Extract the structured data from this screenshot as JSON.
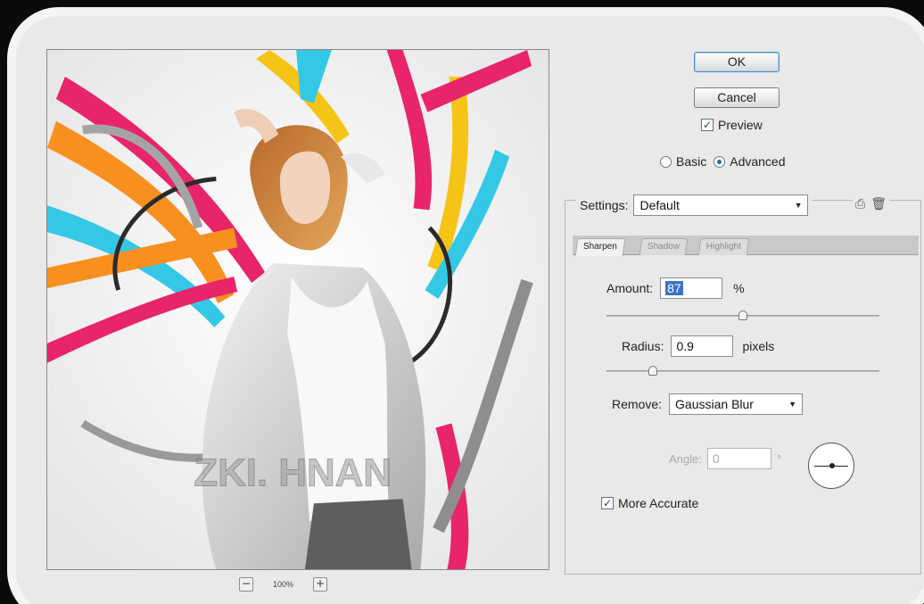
{
  "buttons": {
    "ok": "OK",
    "cancel": "Cancel"
  },
  "preview_check": {
    "label": "Preview",
    "checked": true
  },
  "mode": {
    "basic": "Basic",
    "advanced": "Advanced",
    "selected": "Advanced"
  },
  "settings": {
    "label": "Settings:",
    "value": "Default"
  },
  "tabs": [
    {
      "label": "Sharpen",
      "active": true
    },
    {
      "label": "Shadow",
      "active": false
    },
    {
      "label": "Highlight",
      "active": false
    }
  ],
  "amount": {
    "label": "Amount:",
    "value": "87",
    "unit": "%",
    "slider_fraction": 0.5
  },
  "radius": {
    "label": "Radius:",
    "value": "0.9",
    "unit": "pixels",
    "slider_fraction": 0.16
  },
  "remove": {
    "label": "Remove:",
    "value": "Gaussian Blur"
  },
  "angle": {
    "label": "Angle:",
    "value": "0",
    "unit": "°"
  },
  "more_accurate": {
    "label": "More Accurate",
    "checked": true
  },
  "zoom": {
    "level": "100%",
    "minus": "−",
    "plus": "+"
  },
  "watermark": "ZKI. HNAN",
  "colors": {
    "accent": "#3a74c7",
    "stripe_pink": "#e8246b",
    "stripe_orange": "#f7901e",
    "stripe_cyan": "#34c8e6",
    "stripe_yellow": "#f6c417"
  }
}
